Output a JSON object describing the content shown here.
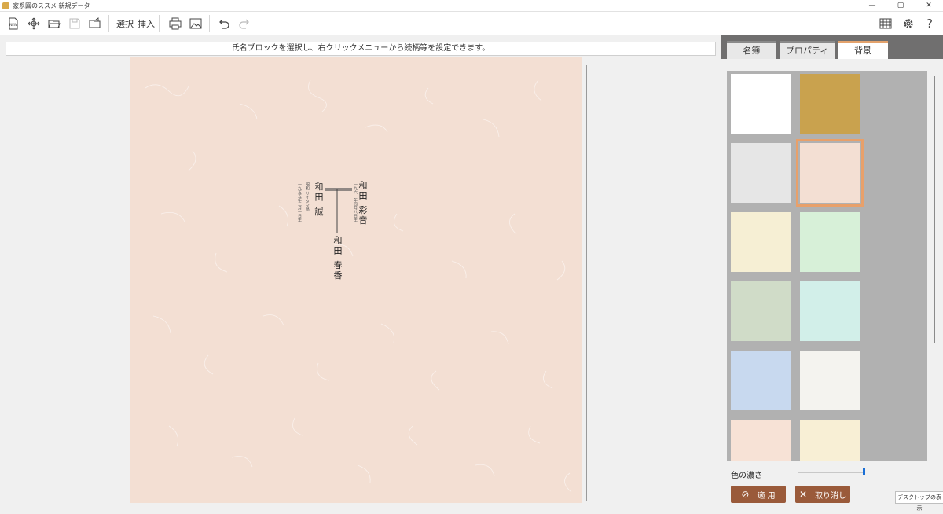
{
  "window": {
    "title": "家系図のススメ 新規データ",
    "minimize": "—",
    "restore": "▢",
    "close": "✕"
  },
  "toolbar": {
    "new_label": "NEW",
    "select_label": "選択",
    "insert_label": "挿入",
    "help_label": "?"
  },
  "canvas": {
    "hint": "氏名ブロックを選択し、右クリックメニューから続柄等を設定できます。"
  },
  "tree": {
    "father": {
      "name": "和田 誠",
      "note": "昭和 サイタマ県",
      "date": "一九五五年二月一日生"
    },
    "mother": {
      "name": "和田 彩音",
      "note": "一九六一年四月八日生"
    },
    "child": {
      "name": "和田 春香"
    }
  },
  "panel": {
    "tabs": [
      {
        "label": "名簿",
        "active": false
      },
      {
        "label": "プロパティ",
        "active": false
      },
      {
        "label": "背景",
        "active": true
      }
    ],
    "swatches": [
      {
        "color": "#ffffff",
        "name": "white"
      },
      {
        "color": "#c9a24e",
        "name": "gold"
      },
      {
        "color": "#e6e6e6",
        "name": "gray"
      },
      {
        "color": "#f3dfd3",
        "name": "peach",
        "selected": true
      },
      {
        "color": "#f6efd4",
        "name": "cream"
      },
      {
        "color": "#d7f0d8",
        "name": "light-green"
      },
      {
        "color": "#d0dcc8",
        "name": "sage"
      },
      {
        "color": "#d2efe9",
        "name": "mint"
      },
      {
        "color": "#c8d9ef",
        "name": "blue"
      },
      {
        "color": "#f4f3ef",
        "name": "ivory"
      },
      {
        "color": "#f7e2d6",
        "name": "pink"
      },
      {
        "color": "#f8efd5",
        "name": "beige"
      }
    ],
    "density_label": "色の濃さ",
    "density_value": 0.98,
    "apply_label": "適 用",
    "cancel_label": "取り消し"
  },
  "tooltip": "デスクトップの表示"
}
